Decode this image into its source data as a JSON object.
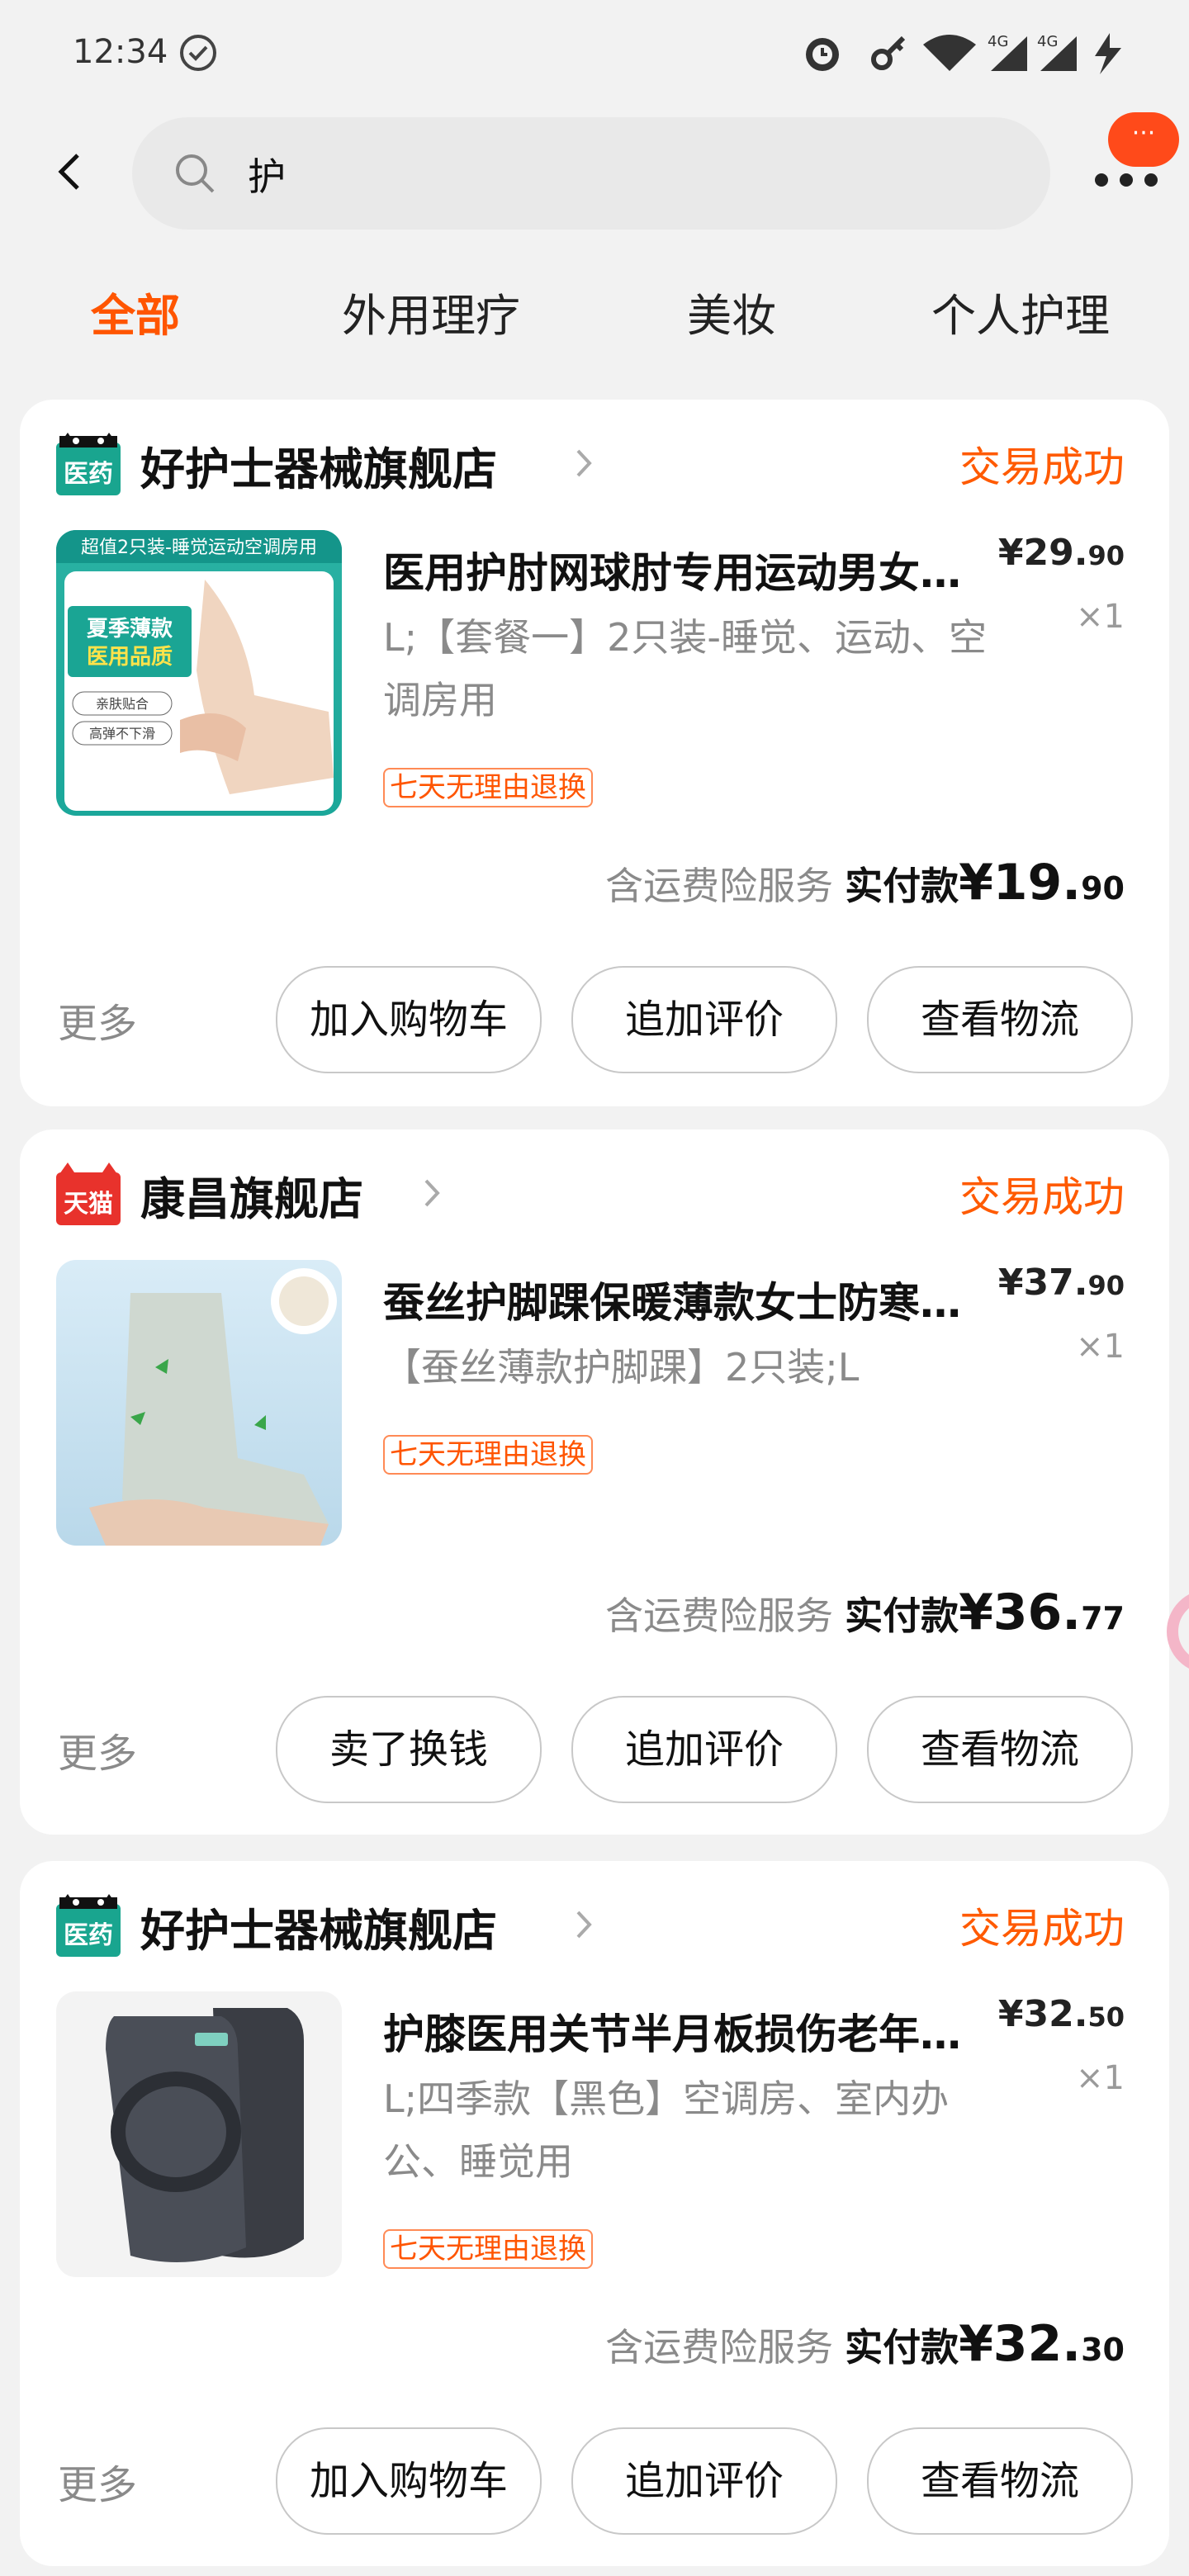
{
  "status_bar": {
    "time": "12:34",
    "icons": [
      "check-circle-icon",
      "alarm-icon",
      "key-icon",
      "wifi-icon",
      "4g-signal-icon",
      "4g-signal-icon",
      "charging-icon"
    ]
  },
  "header": {
    "search_value": "护",
    "more_badge": "···"
  },
  "tabs": [
    {
      "label": "全部",
      "active": true
    },
    {
      "label": "外用理疗",
      "active": false
    },
    {
      "label": "美妆",
      "active": false
    },
    {
      "label": "个人护理",
      "active": false
    }
  ],
  "orders": [
    {
      "store_badge": "医药",
      "store_name": "好护士器械旗舰店",
      "status": "交易成功",
      "product_title": "医用护肘网球肘专用运动男女…",
      "variant": "L;【套餐一】2只装-睡觉、运动、空调房用",
      "price_int": "¥29.",
      "price_dec": "90",
      "qty": "×1",
      "badge": "七天无理由退换",
      "thumb_banner": "超值2只装-睡觉运动空调房用",
      "thumb_tag1": "夏季薄款",
      "thumb_tag2": "医用品质",
      "thumb_pill1": "亲肤贴合",
      "thumb_pill2": "高弹不下滑",
      "insurance": "含运费险服务",
      "paid_label": "实付款",
      "paid_int": "¥19.",
      "paid_dec": "90",
      "more": "更多",
      "buttons": [
        "加入购物车",
        "追加评价",
        "查看物流"
      ]
    },
    {
      "store_badge": "天猫",
      "store_name": "康昌旗舰店",
      "status": "交易成功",
      "product_title": "蚕丝护脚踝保暖薄款女士防寒…",
      "variant": "【蚕丝薄款护脚踝】2只装;L",
      "price_int": "¥37.",
      "price_dec": "90",
      "qty": "×1",
      "badge": "七天无理由退换",
      "insurance": "含运费险服务",
      "paid_label": "实付款",
      "paid_int": "¥36.",
      "paid_dec": "77",
      "more": "更多",
      "buttons": [
        "卖了换钱",
        "追加评价",
        "查看物流"
      ]
    },
    {
      "store_badge": "医药",
      "store_name": "好护士器械旗舰店",
      "status": "交易成功",
      "product_title": "护膝医用关节半月板损伤老年…",
      "variant": "L;四季款【黑色】空调房、室内办公、睡觉用",
      "price_int": "¥32.",
      "price_dec": "50",
      "qty": "×1",
      "badge": "七天无理由退换",
      "insurance": "含运费险服务",
      "paid_label": "实付款",
      "paid_int": "¥32.",
      "paid_dec": "30",
      "more": "更多",
      "buttons": [
        "加入购物车",
        "追加评价",
        "查看物流"
      ]
    }
  ],
  "colors": {
    "accent": "#ff5500",
    "tmall_red": "#e8322c",
    "pharmacy_green": "#19a58f"
  }
}
